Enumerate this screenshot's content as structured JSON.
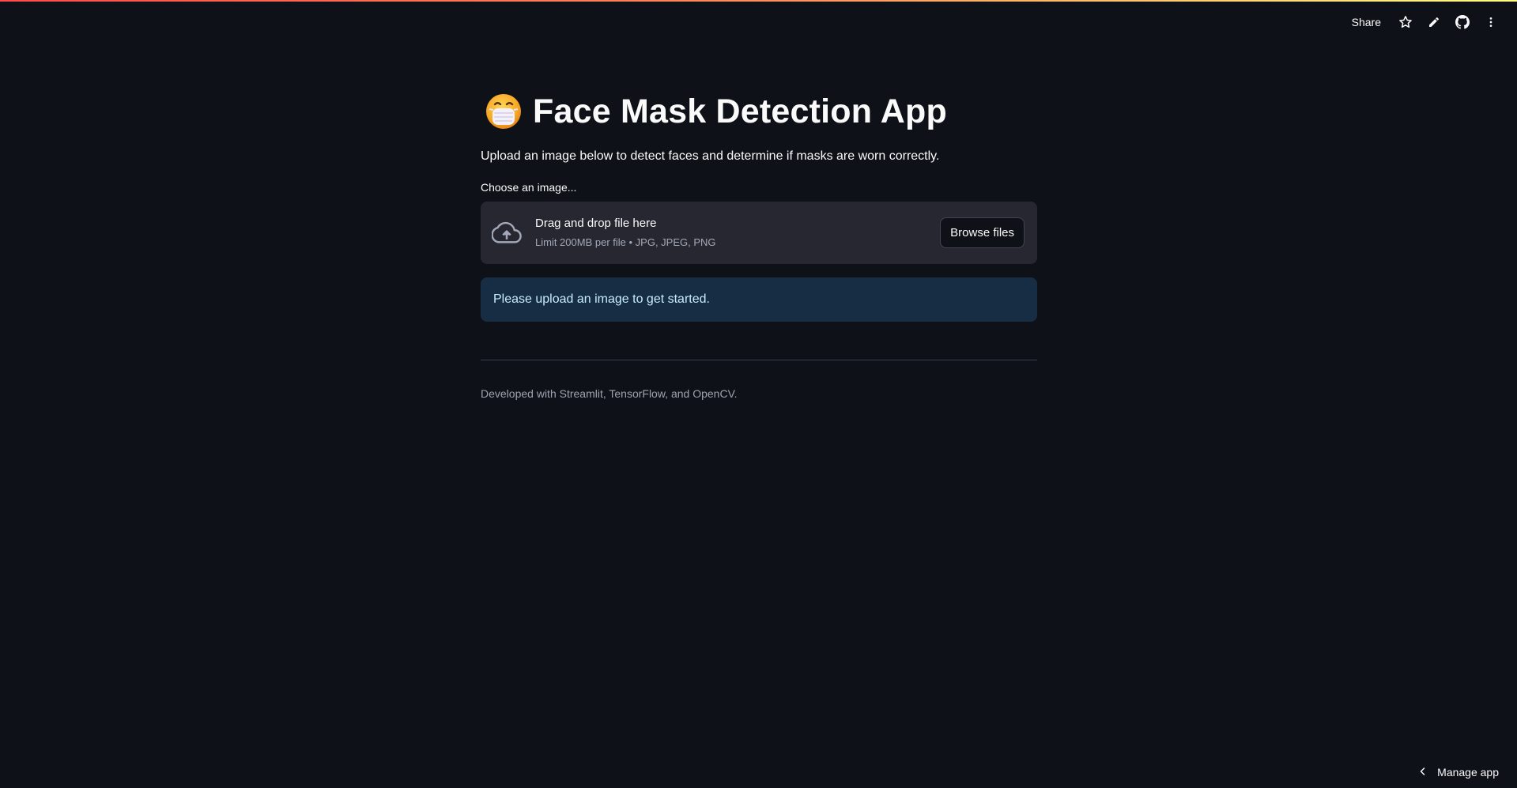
{
  "colors": {
    "background": "#0e1117",
    "surface": "#262730",
    "info_background": "#172d43",
    "info_text": "#c7ebff",
    "accent_gradient_start": "#ff4b4b",
    "accent_gradient_end": "#fffd80"
  },
  "toolbar": {
    "share_label": "Share",
    "icons": [
      "star-icon",
      "pencil-icon",
      "github-icon",
      "more-vert-icon"
    ]
  },
  "header": {
    "emoji": "face-with-medical-mask",
    "title": "Face Mask Detection App"
  },
  "main": {
    "subtitle": "Upload an image below to detect faces and determine if masks are worn correctly.",
    "uploader": {
      "label": "Choose an image...",
      "drop_text": "Drag and drop file here",
      "limit_text": "Limit 200MB per file • JPG, JPEG, PNG",
      "browse_label": "Browse files",
      "icon": "cloud-upload-icon"
    },
    "info_message": "Please upload an image to get started.",
    "footer": "Developed with Streamlit, TensorFlow, and OpenCV."
  },
  "manage_app": {
    "label": "Manage app",
    "icon": "chevron-left-icon"
  }
}
